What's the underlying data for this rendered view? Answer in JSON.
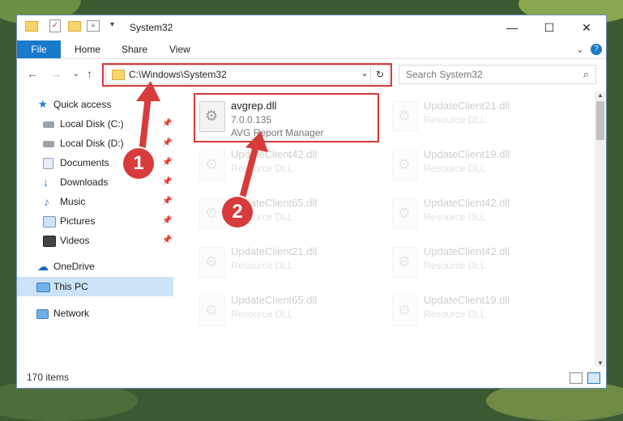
{
  "window": {
    "title": "System32",
    "minimize": "—",
    "maximize": "☐",
    "close": "✕"
  },
  "ribbon": {
    "file": "File",
    "home": "Home",
    "share": "Share",
    "view": "View",
    "expand": "⌄",
    "help": "?"
  },
  "nav": {
    "back": "←",
    "forward": "→",
    "recent": "⌄",
    "up": "↑",
    "address": "C:\\Windows\\System32",
    "address_dropdown": "⌄",
    "refresh": "↻",
    "search_placeholder": "Search System32",
    "search_icon": "⌕"
  },
  "sidebar": {
    "quick_access": "Quick access",
    "items": [
      {
        "label": "Local Disk (C:)",
        "icon": "drive-icon"
      },
      {
        "label": "Local Disk (D:)",
        "icon": "drive-icon"
      },
      {
        "label": "Documents",
        "icon": "documents-icon"
      },
      {
        "label": "Downloads",
        "icon": "downloads-icon"
      },
      {
        "label": "Music",
        "icon": "music-icon"
      },
      {
        "label": "Pictures",
        "icon": "pictures-icon"
      },
      {
        "label": "Videos",
        "icon": "videos-icon"
      }
    ],
    "onedrive": "OneDrive",
    "this_pc": "This PC",
    "network": "Network",
    "pin": "📌"
  },
  "files": {
    "main": {
      "name": "avgrep.dll",
      "version": "7.0.0.135",
      "description": "AVG Report Manager"
    },
    "others": [
      {
        "name": "UpdateClient21.dll",
        "desc": "Resource DLL"
      },
      {
        "name": "UpdateClient42.dll",
        "desc": "Resource DLL"
      },
      {
        "name": "UpdateClient19.dll",
        "desc": "Resource DLL"
      },
      {
        "name": "UpdateClient65.dll",
        "desc": "Resource DLL"
      },
      {
        "name": "UpdateClient42.dll",
        "desc": "Resource DLL"
      },
      {
        "name": "UpdateClient21.dll",
        "desc": "Resource DLL"
      },
      {
        "name": "UpdateClient42.dll",
        "desc": "Resource DLL"
      },
      {
        "name": "UpdateClient65.dll",
        "desc": "Resource DLL"
      },
      {
        "name": "UpdateClient19.dll",
        "desc": "Resource DLL"
      }
    ]
  },
  "status": {
    "count": "170 items"
  },
  "annotations": {
    "step1": "1",
    "step2": "2",
    "color": "#d83b3b"
  }
}
